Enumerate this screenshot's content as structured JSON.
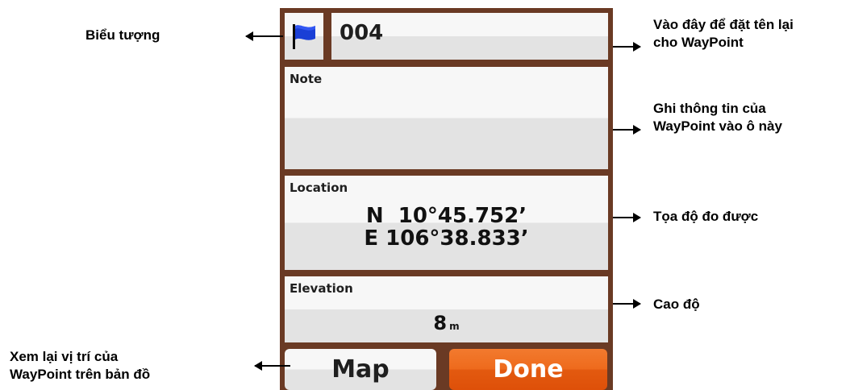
{
  "device": {
    "icon": "blue-flag-icon",
    "waypoint_name": "004",
    "note_label": "Note",
    "note_value": "",
    "location_label": "Location",
    "location_lat": "N  10°45.752’",
    "location_lon": "E 106°38.833’",
    "elevation_label": "Elevation",
    "elevation_value": "8",
    "elevation_unit": "m",
    "map_button": "Map",
    "done_button": "Done"
  },
  "annotations": {
    "icon": "Biểu tượng",
    "rename_line1": "Vào đây để đặt tên lại",
    "rename_line2": "cho WayPoint",
    "note_line1": "Ghi thông tin của",
    "note_line2": "WayPoint vào ô này",
    "coords": "Tọa độ đo được",
    "elevation": "Cao độ",
    "map_line1": "Xem lại vị trí của",
    "map_line2": "WayPoint trên bản đồ"
  },
  "colors": {
    "frame": "#6a3a24",
    "flag": "#1a3fd6",
    "done": "#e35a10"
  }
}
